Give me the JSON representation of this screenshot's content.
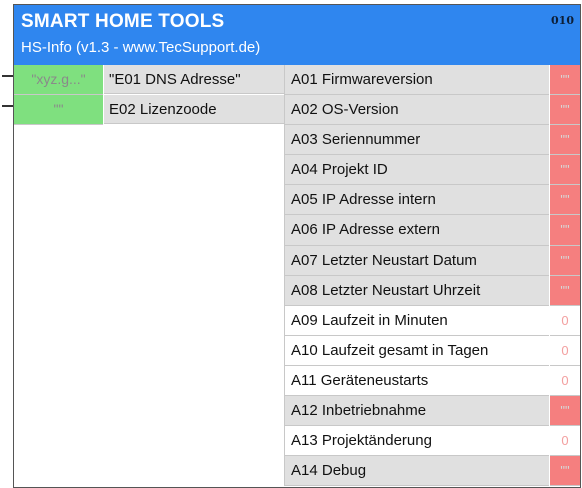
{
  "header": {
    "title": "SMART HOME TOOLS",
    "subtitle": "HS-Info (v1.3 - www.TecSupport.de)",
    "block_id": "010",
    "background": "#2f86ef"
  },
  "inputs": [
    {
      "value": "\"xyz.g...\"",
      "label": "\"E01 DNS Adresse\""
    },
    {
      "value": "\"\"",
      "label": "E02 Lizenzoode"
    }
  ],
  "outputs": [
    {
      "label": "A01 Firmwareversion",
      "value": "\"\"",
      "style": "gray",
      "value_style": "red"
    },
    {
      "label": "A02 OS-Version",
      "value": "\"\"",
      "style": "gray",
      "value_style": "red"
    },
    {
      "label": "A03 Seriennummer",
      "value": "\"\"",
      "style": "gray",
      "value_style": "red"
    },
    {
      "label": "A04 Projekt ID",
      "value": "\"\"",
      "style": "gray",
      "value_style": "red"
    },
    {
      "label": "A05 IP Adresse intern",
      "value": "\"\"",
      "style": "gray",
      "value_style": "red"
    },
    {
      "label": "A06 IP Adresse extern",
      "value": "\"\"",
      "style": "gray",
      "value_style": "red"
    },
    {
      "label": "A07 Letzter Neustart Datum",
      "value": "\"\"",
      "style": "gray",
      "value_style": "red"
    },
    {
      "label": "A08 Letzter Neustart Uhrzeit",
      "value": "\"\"",
      "style": "gray",
      "value_style": "red"
    },
    {
      "label": "A09 Laufzeit in Minuten",
      "value": "0",
      "style": "white",
      "value_style": "white"
    },
    {
      "label": "A10 Laufzeit gesamt in Tagen",
      "value": "0",
      "style": "white",
      "value_style": "white"
    },
    {
      "label": "A11 Geräteneustarts",
      "value": "0",
      "style": "white",
      "value_style": "white"
    },
    {
      "label": "A12 Inbetriebnahme",
      "value": "\"\"",
      "style": "gray",
      "value_style": "red"
    },
    {
      "label": "A13 Projektänderung",
      "value": "0",
      "style": "white",
      "value_style": "white"
    },
    {
      "label": "A14 Debug",
      "value": "\"\"",
      "style": "gray",
      "value_style": "red"
    }
  ],
  "colors": {
    "input_value_bg": "#7fe07f",
    "output_value_bg": "#f57f7f",
    "label_bg": "#e0e0e0"
  }
}
